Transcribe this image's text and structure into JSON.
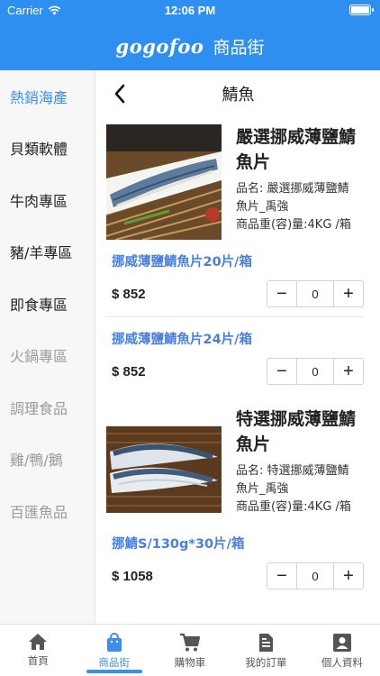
{
  "status": {
    "carrier": "Carrier",
    "time": "12:06 PM"
  },
  "appbar": {
    "logo": "gogofoo",
    "title": "商品街"
  },
  "sidebar": {
    "items": [
      {
        "label": "熱銷海產",
        "state": "active"
      },
      {
        "label": "貝類軟體",
        "state": "normal"
      },
      {
        "label": "牛肉專區",
        "state": "normal"
      },
      {
        "label": "豬/羊專區",
        "state": "normal"
      },
      {
        "label": "即食專區",
        "state": "normal"
      },
      {
        "label": "火鍋專區",
        "state": "dim"
      },
      {
        "label": "調理食品",
        "state": "dim"
      },
      {
        "label": "雞/鴨/鵝",
        "state": "dim"
      },
      {
        "label": "百匯魚品",
        "state": "dim"
      }
    ]
  },
  "main": {
    "title": "鯖魚",
    "products": [
      {
        "name": "嚴選挪威薄鹽鯖魚片",
        "meta_line1": "品名:  嚴選挪威薄鹽鯖",
        "meta_line2": "魚片_禹強",
        "meta_line3": "商品重(容)量:4KG /箱",
        "variants": [
          {
            "name": "挪威薄鹽鯖魚片20片/箱",
            "price": "$ 852",
            "qty": "0"
          },
          {
            "name": "挪威薄鹽鯖魚片24片/箱",
            "price": "$ 852",
            "qty": "0"
          }
        ]
      },
      {
        "name": "特選挪威薄鹽鯖魚片",
        "meta_line1": "品名:  特選挪威薄鹽鯖",
        "meta_line2": "魚片_禹強",
        "meta_line3": "商品重(容)量:4KG /箱",
        "variants": [
          {
            "name": "挪鯖S/130g*30片/箱",
            "price": "$ 1058",
            "qty": "0"
          }
        ]
      }
    ]
  },
  "tabbar": {
    "items": [
      {
        "label": "首頁",
        "icon": "home-icon"
      },
      {
        "label": "商品街",
        "icon": "shopping-bag-icon"
      },
      {
        "label": "購物車",
        "icon": "cart-icon"
      },
      {
        "label": "我的訂單",
        "icon": "document-icon"
      },
      {
        "label": "個人資料",
        "icon": "profile-icon"
      }
    ]
  },
  "colors": {
    "brand": "#2e8ff0",
    "accent": "#3b8ef0",
    "variant_text": "#4a7fe0"
  }
}
